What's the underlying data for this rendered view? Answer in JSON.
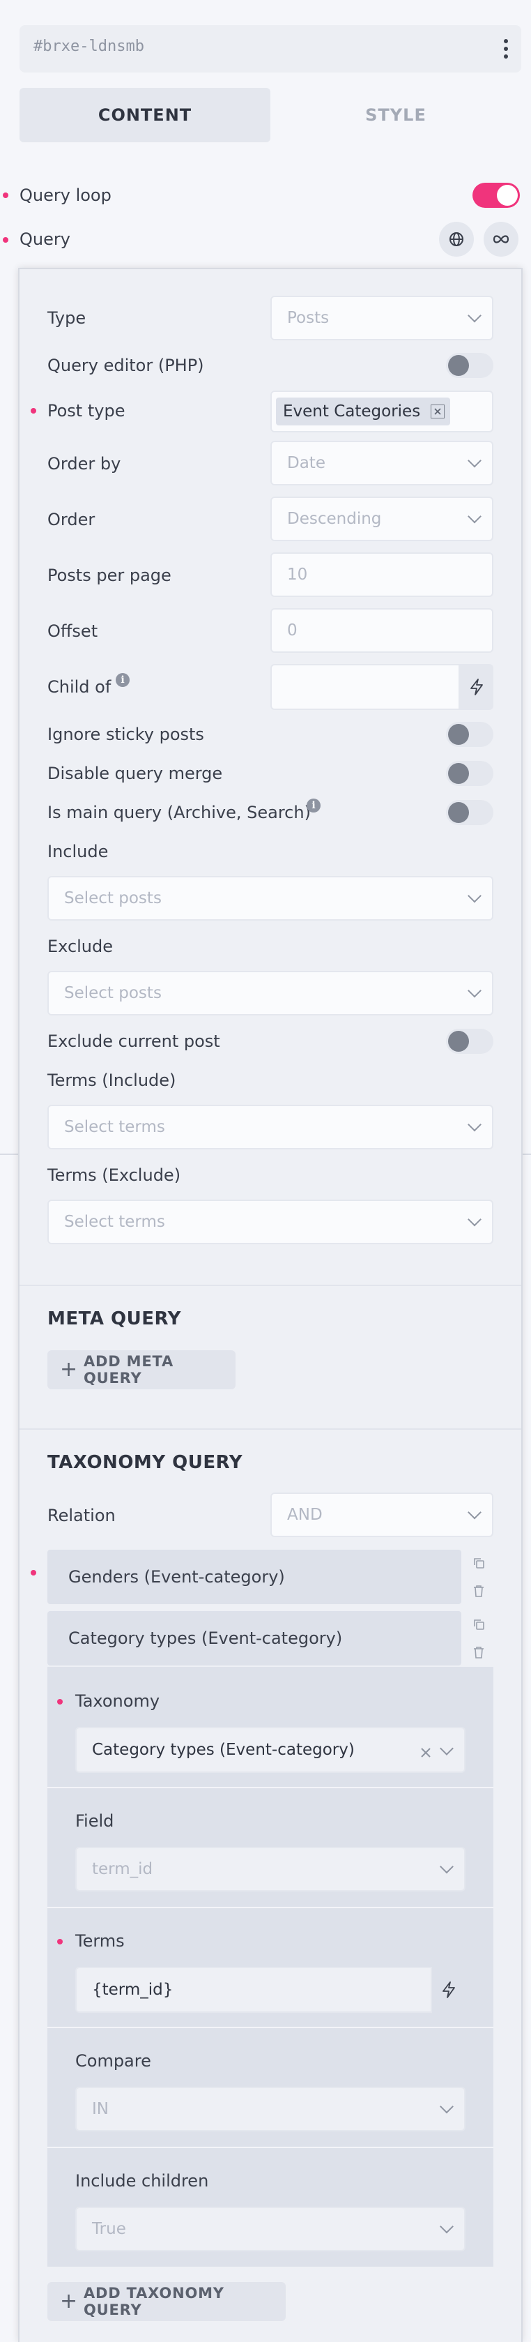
{
  "header": {
    "element_id": "#brxe-ldnsmb",
    "tabs": [
      {
        "label": "CONTENT",
        "active": true
      },
      {
        "label": "STYLE",
        "active": false
      }
    ]
  },
  "query_loop": {
    "label": "Query loop",
    "enabled": true
  },
  "query": {
    "label": "Query",
    "icons": [
      "globe-icon",
      "infinity-icon"
    ]
  },
  "panel": {
    "type": {
      "label": "Type",
      "value": "Posts"
    },
    "query_editor": {
      "label": "Query editor (PHP)",
      "enabled": false
    },
    "post_type": {
      "label": "Post type",
      "tag": "Event Categories"
    },
    "order_by": {
      "label": "Order by",
      "value": "Date"
    },
    "order": {
      "label": "Order",
      "value": "Descending"
    },
    "posts_per_page": {
      "label": "Posts per page",
      "placeholder": "10"
    },
    "offset": {
      "label": "Offset",
      "placeholder": "0"
    },
    "child_of": {
      "label": "Child of",
      "value": ""
    },
    "ignore_sticky": {
      "label": "Ignore sticky posts",
      "enabled": false
    },
    "disable_merge": {
      "label": "Disable query merge",
      "enabled": false
    },
    "is_main_query": {
      "label": "Is main query (Archive, Search)",
      "enabled": false
    },
    "include": {
      "label": "Include",
      "placeholder": "Select posts"
    },
    "exclude": {
      "label": "Exclude",
      "placeholder": "Select posts"
    },
    "exclude_current": {
      "label": "Exclude current post",
      "enabled": false
    },
    "terms_include": {
      "label": "Terms (Include)",
      "placeholder": "Select terms"
    },
    "terms_exclude": {
      "label": "Terms (Exclude)",
      "placeholder": "Select terms"
    }
  },
  "meta_query": {
    "title": "META QUERY",
    "add_label": "ADD META QUERY"
  },
  "taxonomy_query": {
    "title": "TAXONOMY QUERY",
    "relation": {
      "label": "Relation",
      "value": "AND"
    },
    "items": [
      {
        "label": "Genders (Event-category)"
      },
      {
        "label": "Category types (Event-category)"
      }
    ],
    "expanded": {
      "taxonomy": {
        "label": "Taxonomy",
        "value": "Category types (Event-category)"
      },
      "field": {
        "label": "Field",
        "value": "term_id"
      },
      "terms": {
        "label": "Terms",
        "value": "{term_id}"
      },
      "compare": {
        "label": "Compare",
        "value": "IN"
      },
      "include_children": {
        "label": "Include children",
        "value": "True"
      }
    },
    "add_label": "ADD TAXONOMY QUERY"
  },
  "colors": {
    "accent": "#f0347c",
    "panel_bg": "#eef0f5",
    "page_bg": "#f5f6fa"
  }
}
